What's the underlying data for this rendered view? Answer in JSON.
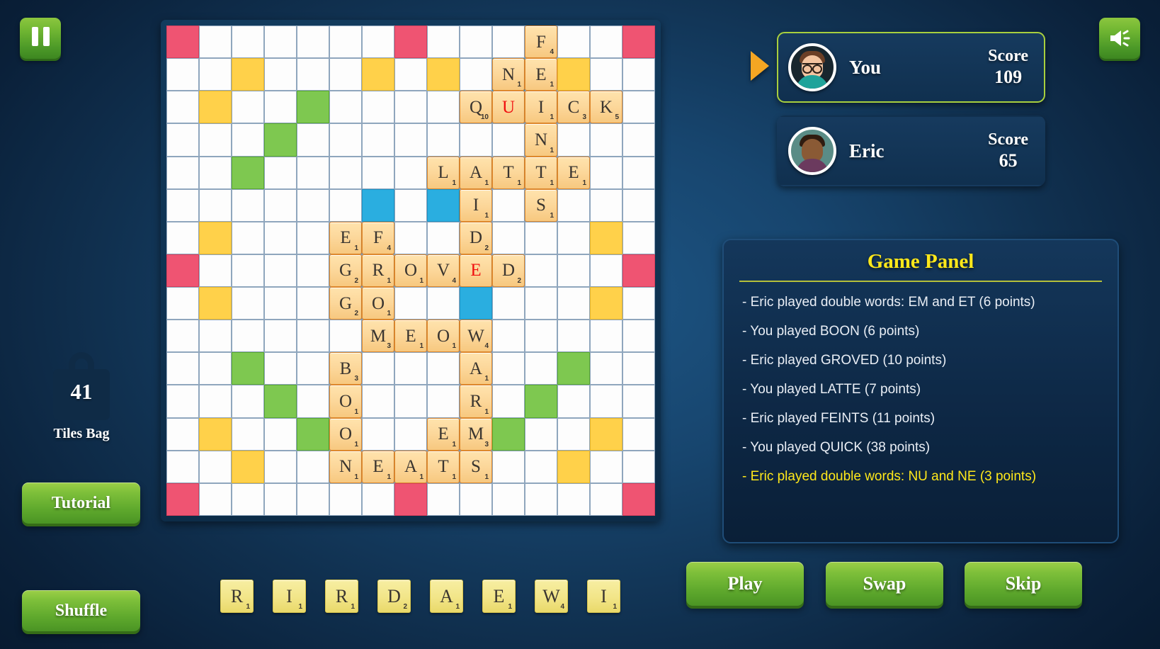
{
  "topbar": {
    "pause_icon": "pause-icon",
    "sound_icon": "sound-on-icon"
  },
  "bag": {
    "count": "41",
    "label": "Tiles Bag",
    "icon": "tile-bag-icon"
  },
  "left_buttons": {
    "tutorial": "Tutorial",
    "shuffle": "Shuffle"
  },
  "players": [
    {
      "name": "You",
      "score_label": "Score",
      "score": "109",
      "active": true
    },
    {
      "name": "Eric",
      "score_label": "Score",
      "score": "65",
      "active": false
    }
  ],
  "game_panel": {
    "title": "Game Panel",
    "log": [
      {
        "text": "- Eric played double words: EM and ET (6 points)",
        "latest": false
      },
      {
        "text": "- You played BOON (6 points)",
        "latest": false
      },
      {
        "text": "- Eric played GROVED (10 points)",
        "latest": false
      },
      {
        "text": "- You played LATTE (7 points)",
        "latest": false
      },
      {
        "text": "- Eric played FEINTS (11 points)",
        "latest": false
      },
      {
        "text": "- You played QUICK (38 points)",
        "latest": false
      },
      {
        "text": "- Eric played double words: NU and NE (3 points)",
        "latest": true
      }
    ]
  },
  "rack": [
    {
      "letter": "R",
      "points": "1"
    },
    {
      "letter": "I",
      "points": "1"
    },
    {
      "letter": "R",
      "points": "1"
    },
    {
      "letter": "D",
      "points": "2"
    },
    {
      "letter": "A",
      "points": "1"
    },
    {
      "letter": "E",
      "points": "1"
    },
    {
      "letter": "W",
      "points": "4"
    },
    {
      "letter": "I",
      "points": "1"
    }
  ],
  "action_buttons": {
    "play": "Play",
    "swap": "Swap",
    "skip": "Skip"
  },
  "colors": {
    "triple_word": "#ef5472",
    "double_word": "#ffd14a",
    "triple_letter": "#7ec850",
    "double_letter": "#2aaee0",
    "tile": "#fcd79a",
    "rack_tile": "#f2e588",
    "accent_green": "#7ec03a",
    "accent_yellow": "#ffe81a",
    "blank_letter": "#f01010"
  },
  "board": {
    "rows": 15,
    "cols": 15,
    "premiums": {
      "tw": [
        [
          0,
          0
        ],
        [
          0,
          7
        ],
        [
          0,
          14
        ],
        [
          7,
          0
        ],
        [
          7,
          14
        ],
        [
          14,
          0
        ],
        [
          14,
          7
        ],
        [
          14,
          14
        ]
      ],
      "dw": [
        [
          1,
          2
        ],
        [
          1,
          6
        ],
        [
          1,
          8
        ],
        [
          1,
          12
        ],
        [
          2,
          1
        ],
        [
          6,
          1
        ],
        [
          6,
          13
        ],
        [
          8,
          1
        ],
        [
          8,
          13
        ],
        [
          12,
          1
        ],
        [
          12,
          13
        ],
        [
          13,
          2
        ],
        [
          13,
          12
        ]
      ],
      "tl": [
        [
          2,
          4
        ],
        [
          3,
          3
        ],
        [
          4,
          2
        ],
        [
          10,
          2
        ],
        [
          10,
          12
        ],
        [
          11,
          3
        ],
        [
          11,
          11
        ],
        [
          12,
          4
        ],
        [
          12,
          10
        ]
      ],
      "dl": [
        [
          1,
          10
        ],
        [
          5,
          6
        ],
        [
          5,
          8
        ],
        [
          8,
          9
        ]
      ]
    },
    "tiles": [
      {
        "r": 0,
        "c": 11,
        "letter": "F",
        "points": "4"
      },
      {
        "r": 1,
        "c": 10,
        "letter": "N",
        "points": "1"
      },
      {
        "r": 1,
        "c": 11,
        "letter": "E",
        "points": "1"
      },
      {
        "r": 2,
        "c": 9,
        "letter": "Q",
        "points": "10"
      },
      {
        "r": 2,
        "c": 10,
        "letter": "U",
        "points": "",
        "blank": true
      },
      {
        "r": 2,
        "c": 11,
        "letter": "I",
        "points": "1"
      },
      {
        "r": 2,
        "c": 12,
        "letter": "C",
        "points": "3"
      },
      {
        "r": 2,
        "c": 13,
        "letter": "K",
        "points": "5"
      },
      {
        "r": 3,
        "c": 11,
        "letter": "N",
        "points": "1"
      },
      {
        "r": 4,
        "c": 8,
        "letter": "L",
        "points": "1"
      },
      {
        "r": 4,
        "c": 9,
        "letter": "A",
        "points": "1"
      },
      {
        "r": 4,
        "c": 10,
        "letter": "T",
        "points": "1"
      },
      {
        "r": 4,
        "c": 11,
        "letter": "T",
        "points": "1"
      },
      {
        "r": 4,
        "c": 12,
        "letter": "E",
        "points": "1"
      },
      {
        "r": 5,
        "c": 9,
        "letter": "I",
        "points": "1"
      },
      {
        "r": 5,
        "c": 11,
        "letter": "S",
        "points": "1"
      },
      {
        "r": 6,
        "c": 5,
        "letter": "E",
        "points": "1"
      },
      {
        "r": 6,
        "c": 6,
        "letter": "F",
        "points": "4"
      },
      {
        "r": 6,
        "c": 9,
        "letter": "D",
        "points": "2"
      },
      {
        "r": 7,
        "c": 5,
        "letter": "G",
        "points": "2"
      },
      {
        "r": 7,
        "c": 6,
        "letter": "R",
        "points": "1"
      },
      {
        "r": 7,
        "c": 7,
        "letter": "O",
        "points": "1"
      },
      {
        "r": 7,
        "c": 8,
        "letter": "V",
        "points": "4"
      },
      {
        "r": 7,
        "c": 9,
        "letter": "E",
        "points": "",
        "blank": true
      },
      {
        "r": 7,
        "c": 10,
        "letter": "D",
        "points": "2"
      },
      {
        "r": 8,
        "c": 5,
        "letter": "G",
        "points": "2"
      },
      {
        "r": 8,
        "c": 6,
        "letter": "O",
        "points": "1"
      },
      {
        "r": 9,
        "c": 6,
        "letter": "M",
        "points": "3"
      },
      {
        "r": 9,
        "c": 7,
        "letter": "E",
        "points": "1"
      },
      {
        "r": 9,
        "c": 8,
        "letter": "O",
        "points": "1"
      },
      {
        "r": 9,
        "c": 9,
        "letter": "W",
        "points": "4"
      },
      {
        "r": 10,
        "c": 5,
        "letter": "B",
        "points": "3"
      },
      {
        "r": 10,
        "c": 9,
        "letter": "A",
        "points": "1"
      },
      {
        "r": 11,
        "c": 5,
        "letter": "O",
        "points": "1"
      },
      {
        "r": 11,
        "c": 9,
        "letter": "R",
        "points": "1"
      },
      {
        "r": 12,
        "c": 5,
        "letter": "O",
        "points": "1"
      },
      {
        "r": 12,
        "c": 8,
        "letter": "E",
        "points": "1"
      },
      {
        "r": 12,
        "c": 9,
        "letter": "M",
        "points": "3"
      },
      {
        "r": 13,
        "c": 5,
        "letter": "N",
        "points": "1"
      },
      {
        "r": 13,
        "c": 6,
        "letter": "E",
        "points": "1"
      },
      {
        "r": 13,
        "c": 7,
        "letter": "A",
        "points": "1"
      },
      {
        "r": 13,
        "c": 8,
        "letter": "T",
        "points": "1"
      },
      {
        "r": 13,
        "c": 9,
        "letter": "S",
        "points": "1"
      }
    ]
  }
}
